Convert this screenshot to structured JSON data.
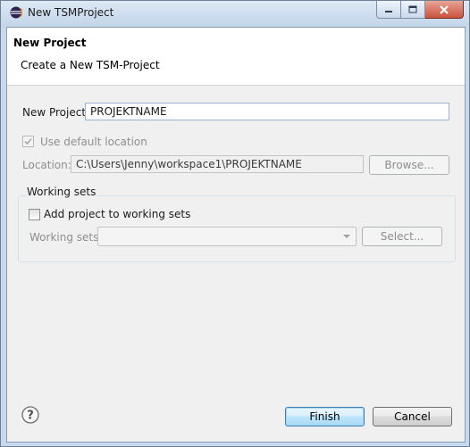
{
  "window": {
    "title": "New TSMProject",
    "icon": "eclipse-icon",
    "caption_buttons": [
      "minimize-icon",
      "maximize-icon",
      "close-icon"
    ]
  },
  "header": {
    "title": "New Project",
    "subtitle": "Create a New TSM-Project"
  },
  "form": {
    "project_label": "New Project",
    "project_value": "PROJEKTNAME",
    "use_default_label": "Use default location",
    "use_default_checked": true,
    "location_label": "Location:",
    "location_value": "C:\\Users\\Jenny\\workspace1\\PROJEKTNAME",
    "browse_label": "Browse..."
  },
  "working_sets": {
    "group_label": "Working sets",
    "add_label": "Add project to working sets",
    "add_checked": false,
    "sets_label": "Working sets:",
    "sets_value": "",
    "select_label": "Select..."
  },
  "footer": {
    "help_icon": "help-icon",
    "finish_label": "Finish",
    "cancel_label": "Cancel"
  },
  "colors": {
    "frame": "#c7d9ee",
    "client": "#f0f0f0",
    "disabled_text": "#8e8e8e",
    "default_button": "#bee6fd"
  }
}
